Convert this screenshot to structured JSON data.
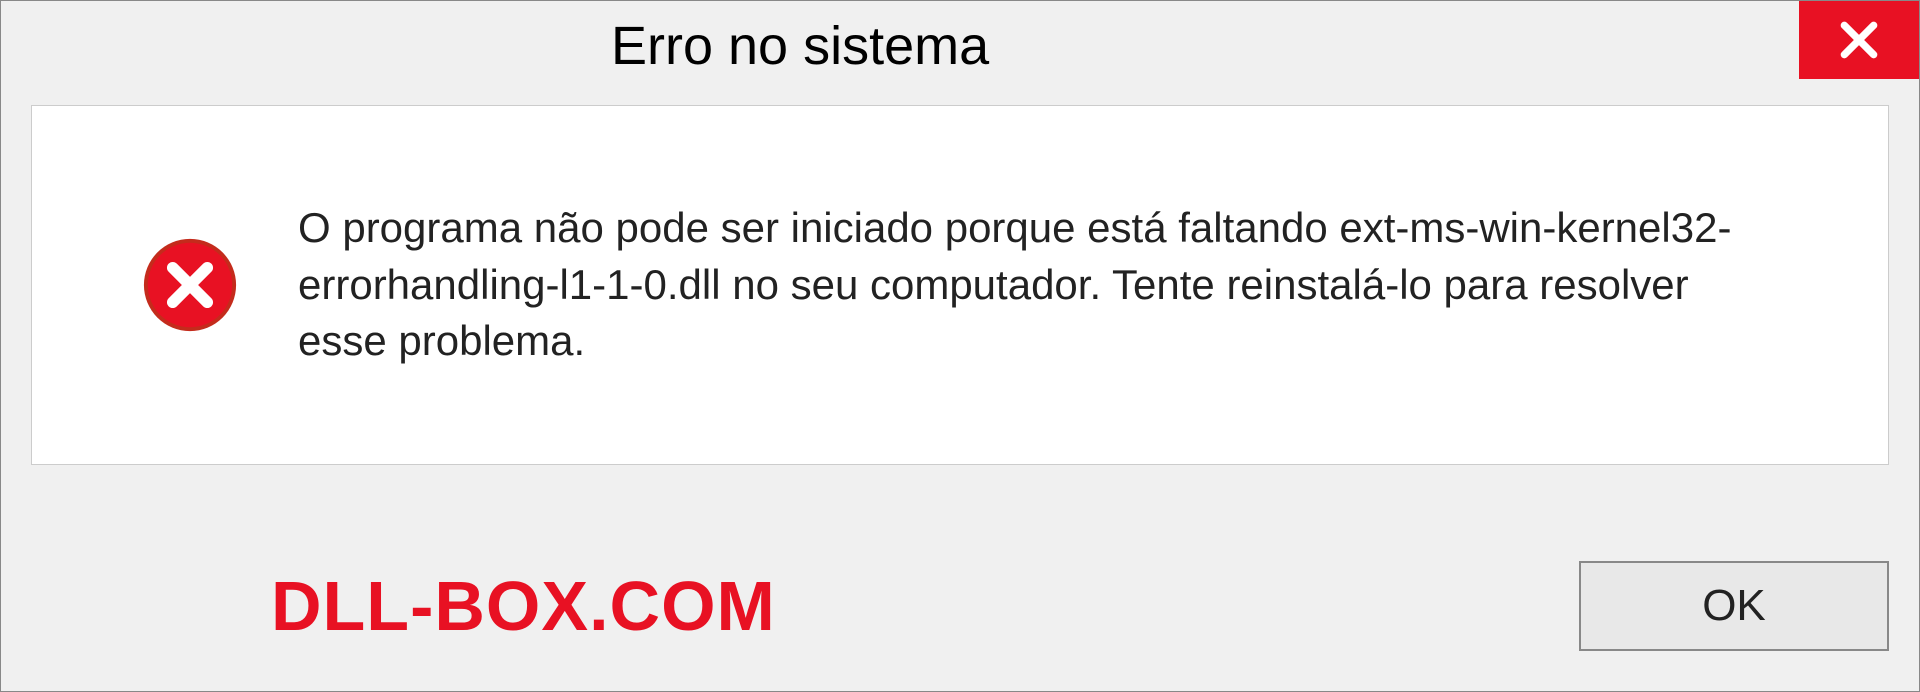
{
  "dialog": {
    "title": "Erro no sistema",
    "message": "O programa não pode ser iniciado porque está faltando ext-ms-win-kernel32-errorhandling-l1-1-0.dll no seu computador. Tente reinstalá-lo para resolver esse problema.",
    "ok_label": "OK"
  },
  "watermark": "DLL-BOX.COM"
}
